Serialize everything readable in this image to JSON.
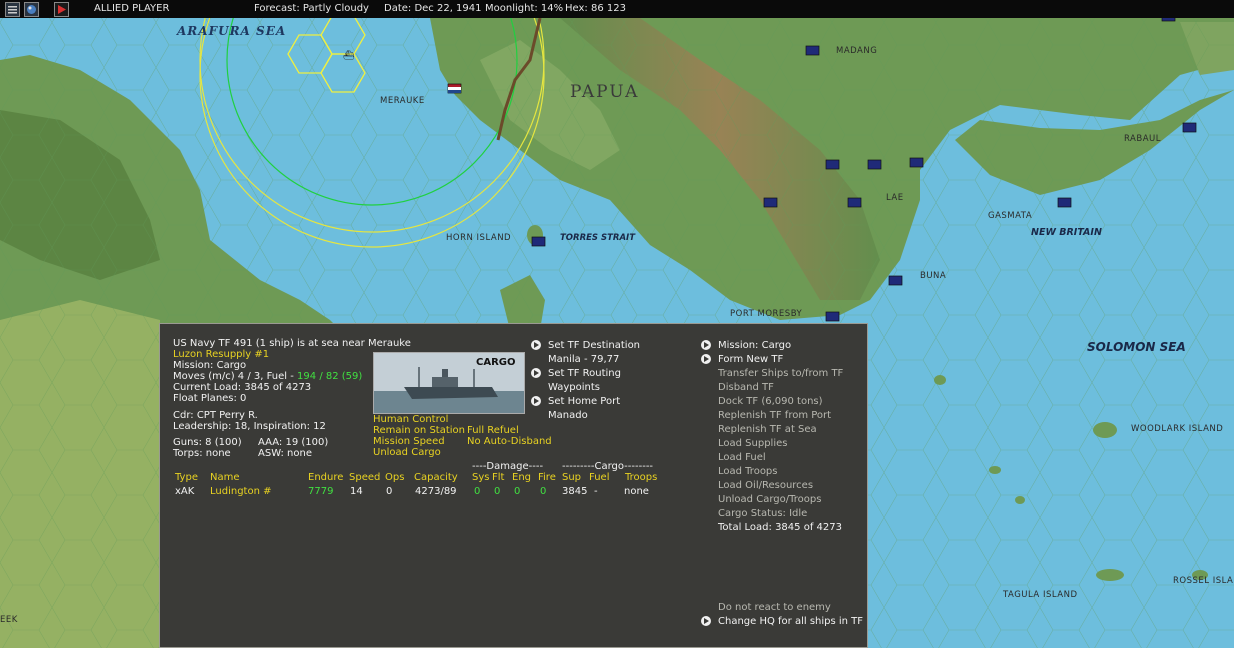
{
  "topbar": {
    "player": "ALLIED PLAYER",
    "forecast": "Forecast: Partly Cloudy",
    "date": "Date: Dec 22, 1941",
    "moonlight": "Moonlight: 14%",
    "hex": "Hex: 86 123"
  },
  "map": {
    "labels": {
      "arafura_sea": "ARAFURA SEA",
      "merauke": "MERAUKE",
      "papua": "PAPUA",
      "madang": "MADANG",
      "rabaul": "RABAUL",
      "lae": "LAE",
      "gasmata": "GASMATA",
      "new_britain": "NEW BRITAIN",
      "horn_island": "HORN ISLAND",
      "torres_strait": "TORRES STRAIT",
      "buna": "BUNA",
      "port_moresby": "PORT MORESBY",
      "solomon_sea": "SOLOMON SEA",
      "woodlark_island": "WOODLARK ISLAND",
      "tagula_island": "TAGULA ISLAND",
      "rossel_island": "ROSSEL ISLA",
      "edge_left": "EEK"
    }
  },
  "panel": {
    "header": "US Navy TF 491 (1 ship) is at sea near Merauke",
    "tf_name": "Luzon Resupply #1",
    "mission": "Mission: Cargo",
    "moves_prefix": "Moves (m/c) 4 / 3, Fuel - ",
    "moves_fuel": "194 / 82 (59)",
    "current_load": "Current Load: 3845 of 4273",
    "float_planes": "Float Planes: 0",
    "commander": "Cdr: CPT Perry R.",
    "leadership": "Leadership: 18, Inspiration: 12",
    "guns": "Guns: 8 (100)",
    "aaa": "AAA: 19 (100)",
    "torps": "Torps: none",
    "asw": "ASW: none",
    "ship_image_label": "CARGO",
    "settings": {
      "human_control": "Human Control",
      "remain_on_station": "Remain on Station",
      "mission_speed": "Mission Speed",
      "unload_cargo": "Unload Cargo",
      "full_refuel": "Full Refuel",
      "no_auto_disband": "No Auto-Disband"
    },
    "mid_actions": {
      "set_tf_destination": "Set TF Destination",
      "destination_value": "Manila - 79,77",
      "set_tf_routing": "Set TF Routing",
      "waypoints": "Waypoints",
      "set_home_port": "Set Home Port",
      "home_port_value": "Manado"
    },
    "right_actions": {
      "mission_cargo": "Mission: Cargo",
      "form_new_tf": "Form New TF",
      "transfer_ships": "Transfer Ships to/from TF",
      "disband_tf": "Disband TF",
      "dock_tf": "Dock TF (6,090 tons)",
      "replenish_port": "Replenish TF from Port",
      "replenish_sea": "Replenish TF at Sea",
      "load_supplies": "Load Supplies",
      "load_fuel": "Load Fuel",
      "load_troops": "Load Troops",
      "load_oil": "Load Oil/Resources",
      "unload_cargo_troops": "Unload Cargo/Troops",
      "cargo_status": "Cargo Status: Idle",
      "total_load": "Total Load: 3845 of 4273",
      "do_not_react": "Do not react to enemy",
      "change_hq": "Change HQ for all ships in TF"
    },
    "table": {
      "group_damage": "----Damage----",
      "group_cargo": "---------Cargo--------",
      "headers": {
        "type": "Type",
        "name": "Name",
        "endure": "Endure",
        "speed": "Speed",
        "ops": "Ops",
        "capacity": "Capacity",
        "sys": "Sys",
        "flt": "Flt",
        "eng": "Eng",
        "fire": "Fire",
        "sup": "Sup",
        "fuel": "Fuel",
        "troops": "Troops"
      },
      "row": {
        "type": "xAK",
        "name": "Ludington #",
        "endure": "7779",
        "speed": "14",
        "ops": "0",
        "capacity": "4273/89",
        "sys": "0",
        "flt": "0",
        "eng": "0",
        "fire": "0",
        "sup": "3845",
        "fuel": "-",
        "troops": "none"
      }
    }
  }
}
